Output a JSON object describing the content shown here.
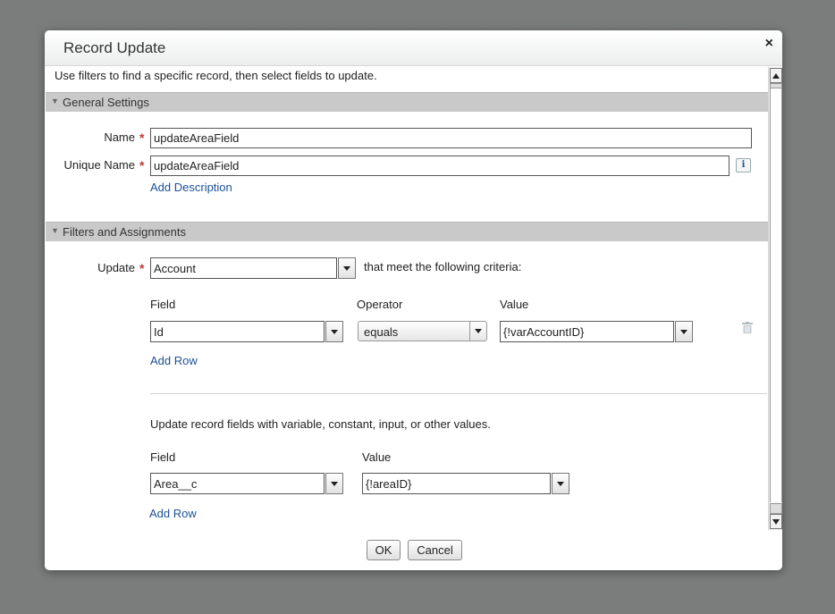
{
  "dialog": {
    "title": "Record Update",
    "close_glyph": "×",
    "intro": "Use filters to find a specific record, then select fields to update."
  },
  "general": {
    "header": "General Settings",
    "name_label": "Name",
    "name_value": "updateAreaField",
    "unique_label": "Unique Name",
    "unique_value": "updateAreaField",
    "info_glyph": "i",
    "add_description": "Add Description",
    "required_glyph": "*"
  },
  "filters": {
    "header": "Filters and Assignments",
    "update_label": "Update",
    "update_value": "Account",
    "criteria_text": "that meet the following criteria:",
    "col_field": "Field",
    "col_operator": "Operator",
    "col_value": "Value",
    "row_field": "Id",
    "row_operator": "equals",
    "row_value": "{!varAccountID}",
    "add_row": "Add Row"
  },
  "assignments": {
    "instruction": "Update record fields with variable, constant, input, or other values.",
    "col_field": "Field",
    "col_value": "Value",
    "row_field": "Area__c",
    "row_value": "{!areaID}",
    "add_row": "Add Row"
  },
  "footer": {
    "ok": "OK",
    "cancel": "Cancel"
  },
  "icons": {
    "section_toggle": "triangle-down-icon",
    "delete": "trash-icon",
    "info": "info-icon"
  },
  "colors": {
    "required": "#c23934",
    "link": "#1b5297",
    "section_bar": "#c9c9c9",
    "backdrop": "#7a7d7c"
  }
}
